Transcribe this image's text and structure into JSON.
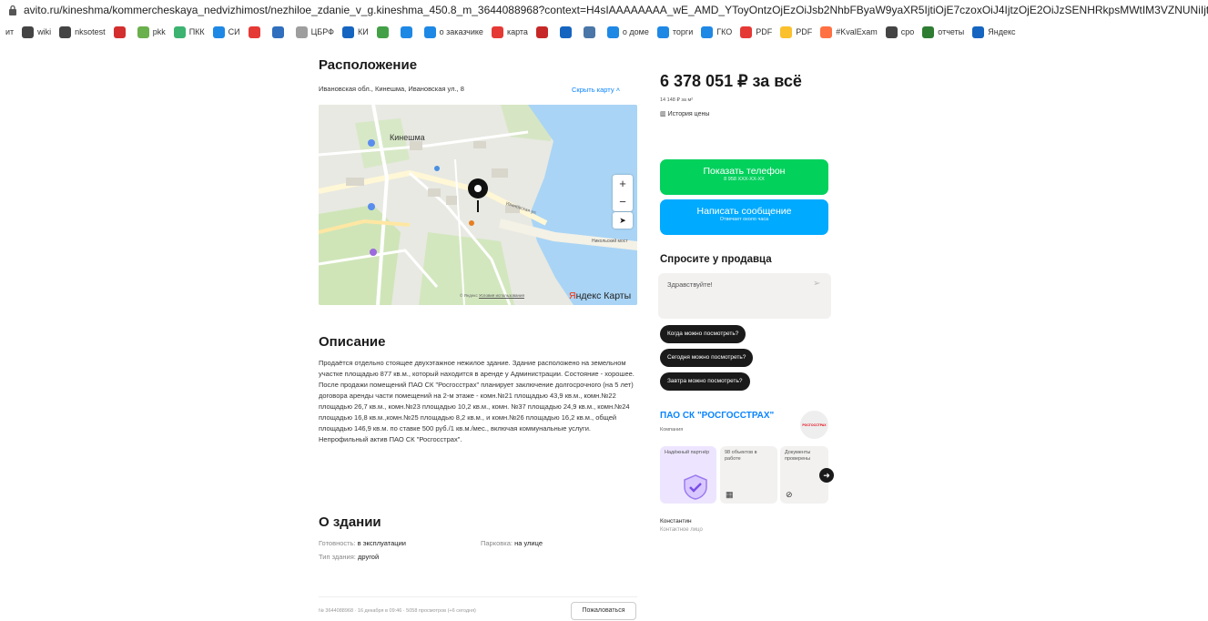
{
  "browser": {
    "url": "avito.ru/kineshma/kommercheskaya_nedvizhimost/nezhiloe_zdanie_v_g.kineshma_450.8_m_3644088968?context=H4sIAAAAAAAA_wE_AMD_YToyOntzOjEzOiJsb2NhbFByaW9yaXR5IjtiOjE7czoxOiJ4IjtzOjE2OiJzSENHRkpsMWtIM3VZNUNiIjt9Yo8...",
    "bookmarks": [
      {
        "label": "ит",
        "icon": "bookmark-icon",
        "color": "#ffffff"
      },
      {
        "label": "wiki",
        "icon": "globe-icon",
        "color": "#444444"
      },
      {
        "label": "nksotest",
        "icon": "globe-icon",
        "color": "#444444"
      },
      {
        "label": "",
        "icon": "red-square-icon",
        "color": "#d32f2f"
      },
      {
        "label": "pkk",
        "icon": "plant-icon",
        "color": "#6ab04c"
      },
      {
        "label": "ПКК",
        "icon": "leaf-icon",
        "color": "#3cb371"
      },
      {
        "label": "СИ",
        "icon": "app-icon",
        "color": "#1e88e5"
      },
      {
        "label": "",
        "icon": "star-icon",
        "color": "#e53935"
      },
      {
        "label": "",
        "icon": "doc-icon",
        "color": "#2f6fbd"
      },
      {
        "label": "ЦБРФ",
        "icon": "bank-icon",
        "color": "#9e9e9e"
      },
      {
        "label": "КИ",
        "icon": "chart-icon",
        "color": "#1565c0"
      },
      {
        "label": "",
        "icon": "puzzle-icon",
        "color": "#43a047"
      },
      {
        "label": "",
        "icon": "arrow-icon",
        "color": "#1e88e5"
      },
      {
        "label": "о заказчике",
        "icon": "target-icon",
        "color": "#1e88e5"
      },
      {
        "label": "карта",
        "icon": "pin-icon",
        "color": "#e53935"
      },
      {
        "label": "",
        "icon": "cloud-icon",
        "color": "#c62828"
      },
      {
        "label": "",
        "icon": "check-icon",
        "color": "#1565c0"
      },
      {
        "label": "",
        "icon": "vk-icon",
        "color": "#4a76a8"
      },
      {
        "label": "о доме",
        "icon": "house-icon",
        "color": "#1e88e5"
      },
      {
        "label": "торги",
        "icon": "hammer-icon",
        "color": "#1e88e5"
      },
      {
        "label": "ГКО",
        "icon": "app-icon",
        "color": "#1e88e5"
      },
      {
        "label": "PDF",
        "icon": "heart-icon",
        "color": "#e53935"
      },
      {
        "label": "PDF",
        "icon": "grid-icon",
        "color": "#fbc02d"
      },
      {
        "label": "#KvalExam",
        "icon": "mail-icon",
        "color": "#ff7043"
      },
      {
        "label": "cpo",
        "icon": "globe-icon",
        "color": "#444444"
      },
      {
        "label": "отчеты",
        "icon": "sheet-icon",
        "color": "#2e7d32"
      },
      {
        "label": "Яндекс",
        "icon": "disk-icon",
        "color": "#1565c0"
      }
    ]
  },
  "location": {
    "title": "Расположение",
    "address": "Ивановская обл., Кинешма, Ивановская ул., 8",
    "hide_map": "Скрыть карту",
    "map_labels": [
      "Кинешма",
      "Ивановская ул.",
      "Никольский мост"
    ],
    "map_brand": "Яндекс Карты",
    "map_brand_first": "Я",
    "map_brand_rest": "ндекс Карты",
    "map_terms_prefix": "© Яндекс",
    "map_terms_link": "Условия использования",
    "zoom_in": "+",
    "zoom_out": "−",
    "locate": "➤"
  },
  "description": {
    "title": "Описание",
    "text": "Продаётся отдельно стоящее двухэтажное нежилое здание. Здание расположено на земельном участке площадью 877 кв.м., который находится в аренде у Администрации. Состояние - хорошее. После продажи помещений ПАО СК \"Росгосстрах\" планирует заключение долгосрочного (на 5 лет) договора аренды части помещений на 2-м этаже - комн.№21 площадью 43,9 кв.м., комн.№22 площадью 26,7 кв.м., комн.№23 площадью 10,2 кв.м., комн. №37 площадью 24,9 кв.м., комн.№24 площадью 16,8 кв.м.,комн.№25 площадью 8,2 кв.м., и комн.№26 площадью 16,2 кв.м., общей площадью 146,9 кв.м. по ставке 500 руб./1 кв.м./мес., включая коммунальные услуги. Непрофильный актив ПАО СК \"Росгосстрах\"."
  },
  "building": {
    "title": "О здании",
    "readiness_label": "Готовность:",
    "readiness_value": "в эксплуатации",
    "parking_label": "Парковка:",
    "parking_value": "на улице",
    "type_label": "Тип здания:",
    "type_value": "другой"
  },
  "footer": {
    "meta": "№ 3644088968 · 16 декабря в 09:46 · 5058 просмотров (+6 сегодня)",
    "complain": "Пожаловаться"
  },
  "offer": {
    "price": "6 378 051 ₽ за всё",
    "price_per_m2": "14 148 ₽ за м²",
    "price_history": "История цены",
    "show_phone": "Показать телефон",
    "phone_masked": "8 958 XXX-XX-XX",
    "write_message": "Написать сообщение",
    "reply_time": "Отвечает около часа"
  },
  "ask": {
    "title": "Спросите у продавца",
    "input_value": "Здравствуйте!",
    "send": "➢",
    "chips": [
      "Когда можно посмотреть?",
      "Сегодня можно посмотреть?",
      "Завтра можно посмотреть?"
    ]
  },
  "seller": {
    "name": "ПАО СК \"РОСГОССТРАХ\"",
    "type": "Компания",
    "logo_text": "РОСГОССТРАХ",
    "cards": [
      {
        "text": "Надёжный партнёр",
        "icon": "shield-check-icon"
      },
      {
        "text": "98 объектов в работе",
        "icon": "building-icon"
      },
      {
        "text": "Документы проверены",
        "icon": "check-circle-icon"
      }
    ],
    "contact_name": "Константин",
    "contact_role": "Контактное лицо"
  }
}
